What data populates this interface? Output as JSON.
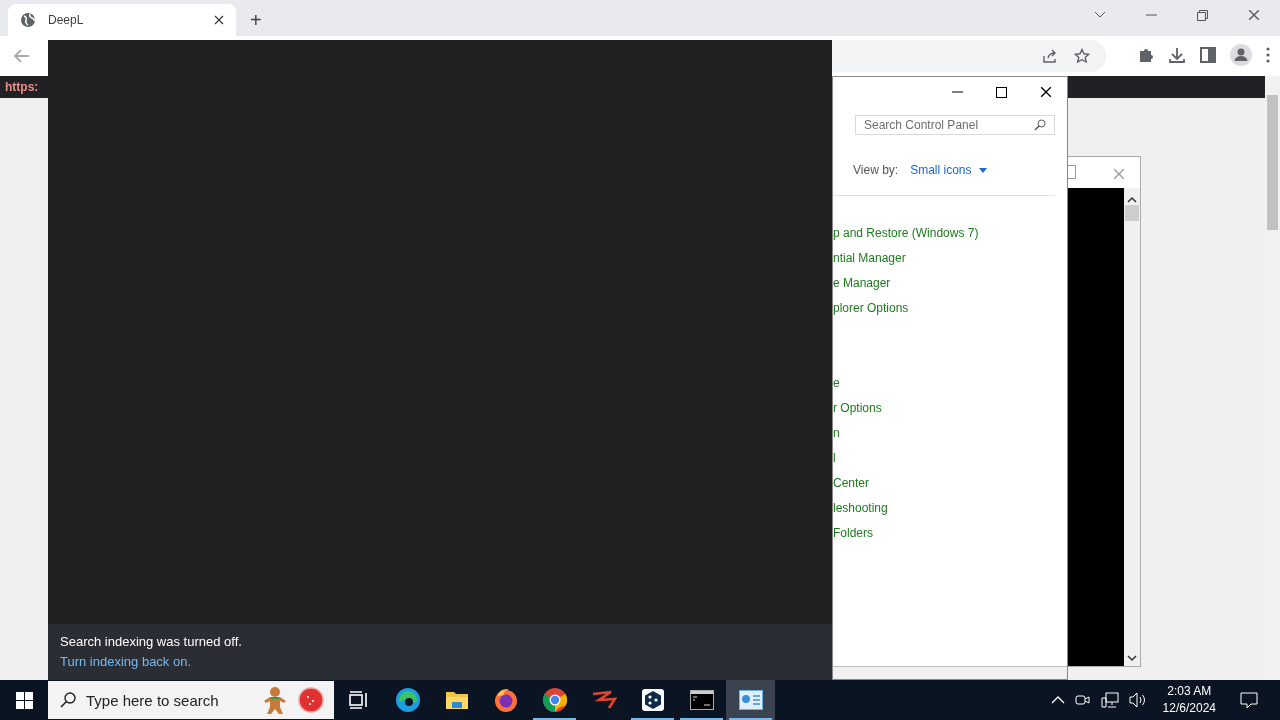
{
  "browser": {
    "tabs": [
      {
        "title": "DeepL",
        "selected": true
      }
    ],
    "new_tab_label": "+",
    "page_text": "https:"
  },
  "control_panel": {
    "search": {
      "placeholder": "Search Control Panel"
    },
    "view_by": {
      "label": "View by:",
      "value": "Small icons"
    },
    "link_groups": [
      [
        "p and Restore (Windows 7)",
        "ntial Manager",
        "e Manager",
        "plorer Options"
      ],
      [
        "e",
        "r Options",
        "n",
        "l",
        "Center",
        "leshooting",
        "Folders"
      ]
    ]
  },
  "search_panel": {
    "message": "Search indexing was turned off.",
    "link": "Turn indexing back on."
  },
  "taskbar": {
    "search": {
      "placeholder": "Type here to search"
    },
    "apps": [
      {
        "kind": "task-view",
        "running": false,
        "active": false
      },
      {
        "kind": "edge",
        "running": false,
        "active": false
      },
      {
        "kind": "explorer",
        "running": false,
        "active": false
      },
      {
        "kind": "firefox",
        "running": false,
        "active": false
      },
      {
        "kind": "chrome",
        "running": true,
        "active": false
      },
      {
        "kind": "zigzag",
        "running": false,
        "active": false
      },
      {
        "kind": "deepl",
        "running": true,
        "active": false
      },
      {
        "kind": "terminal",
        "running": true,
        "active": false
      },
      {
        "kind": "control-panel",
        "running": true,
        "active": true
      }
    ],
    "clock": {
      "time": "2:03 AM",
      "date": "12/6/2024"
    }
  }
}
